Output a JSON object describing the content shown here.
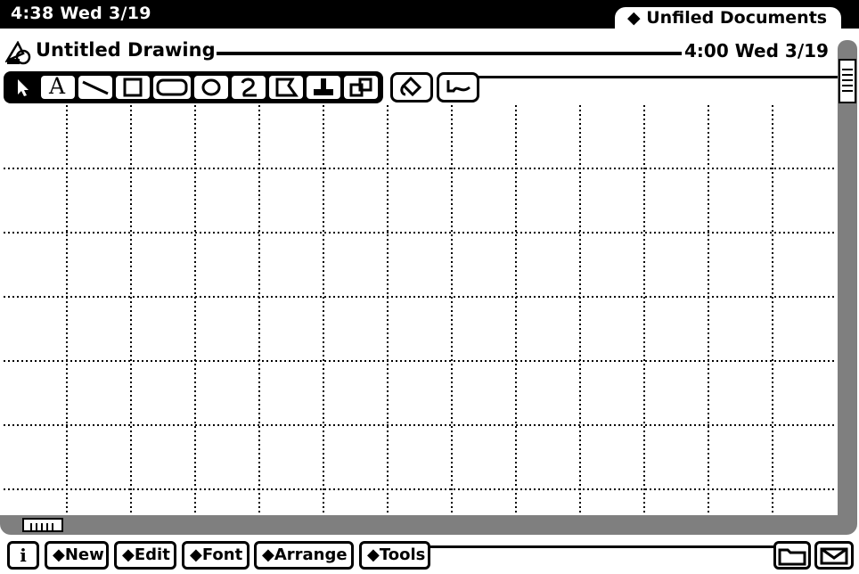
{
  "status_bar": {
    "clock": "4:38 Wed 3/19",
    "folder_tab": "◆ Unfiled Documents"
  },
  "document": {
    "title": "Untitled Drawing",
    "timestamp": "4:00 Wed 3/19"
  },
  "toolbar": {
    "tools": [
      "select-arrow",
      "text",
      "line",
      "rectangle",
      "rounded-rectangle",
      "oval",
      "freehand",
      "polygon",
      "stamp",
      "shapes"
    ],
    "text_tool_glyph": "A",
    "extra_tools": [
      "fill-bucket",
      "pen-style"
    ]
  },
  "bottom_bar": {
    "info_label": "i",
    "new_label": "◆New",
    "edit_label": "◆Edit",
    "font_label": "◆Font",
    "arrange_label": "◆Arrange",
    "tools_label": "◆Tools"
  },
  "colors": {
    "ink": "#000000",
    "paper": "#ffffff",
    "scrollbar": "#7f7f7f"
  }
}
